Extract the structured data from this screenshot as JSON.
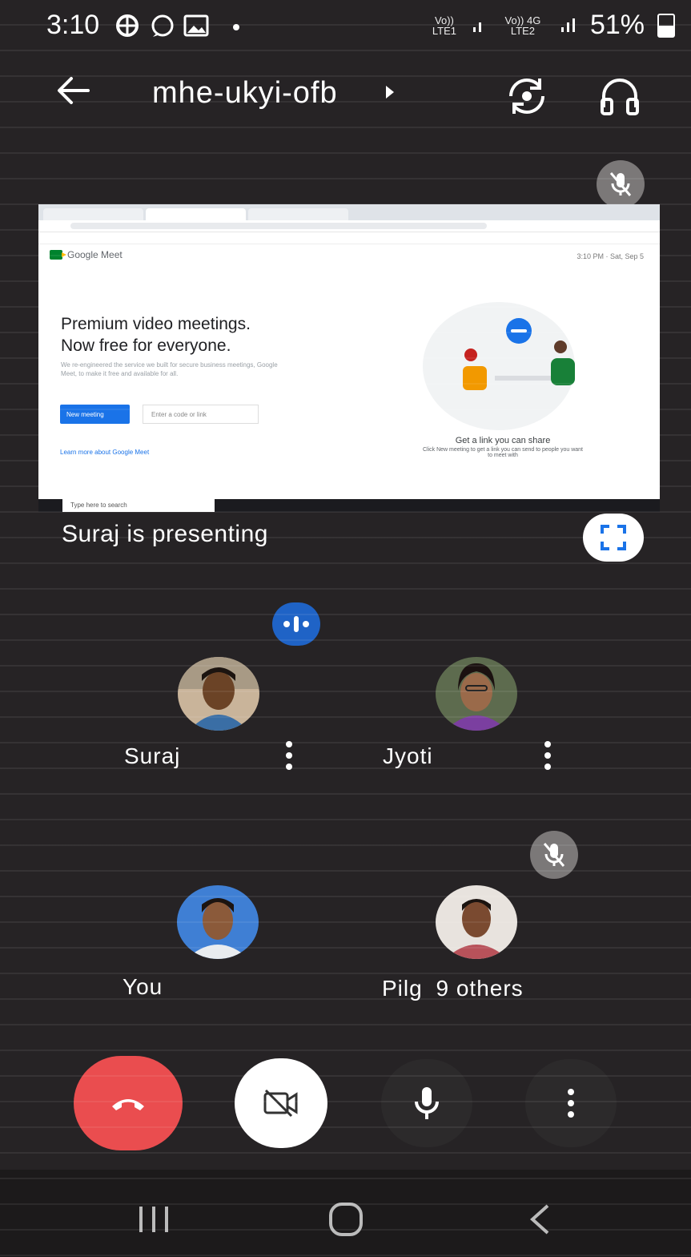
{
  "status_bar": {
    "time": "3:10",
    "icons": [
      "grid-app-icon",
      "whatsapp-icon",
      "image-icon",
      "dot-icon"
    ],
    "sim1_label": "Vo)) LTE1",
    "sim2_label": "Vo)) 4G LTE2",
    "battery": "51%",
    "battery_level": 0.51
  },
  "header": {
    "meeting_code": "mhe-ukyi-ofb",
    "back_icon": "arrow-left-icon",
    "switch_camera_icon": "camera-switch-icon",
    "audio_icon": "headphones-icon"
  },
  "presentation": {
    "presenter_text": "Suraj is presenting",
    "shared_screen": {
      "brand": "Google Meet",
      "time_text": "3:10 PM · Sat, Sep 5",
      "hero_line1": "Premium video meetings.",
      "hero_line2": "Now free for everyone.",
      "hero_sub": "We re-engineered the service we built for secure business meetings, Google Meet, to make it free and available for all.",
      "new_meeting": "New meeting",
      "code_placeholder": "Enter a code or link",
      "learn_more": "Learn more about Google Meet",
      "illustration_caption": "Get a link you can share",
      "illustration_sub": "Click New meeting to get a link you can send to people you want to meet with",
      "taskbar_search": "Type here to search"
    }
  },
  "participants": [
    {
      "name": "Suraj",
      "muted": false
    },
    {
      "name": "Jyoti",
      "muted": false
    },
    {
      "name": "You",
      "muted": false
    },
    {
      "name": "Pilg",
      "muted": true,
      "others": "9 others"
    }
  ],
  "controls": {
    "end_call_icon": "phone-hangup-icon",
    "camera_icon": "camera-off-icon",
    "mic_icon": "microphone-icon",
    "more_icon": "more-vertical-icon",
    "end_call_color": "#ea4d4f"
  },
  "nav": {
    "recents_icon": "recents-icon",
    "home_icon": "home-icon",
    "back_icon": "chevron-left-icon"
  }
}
